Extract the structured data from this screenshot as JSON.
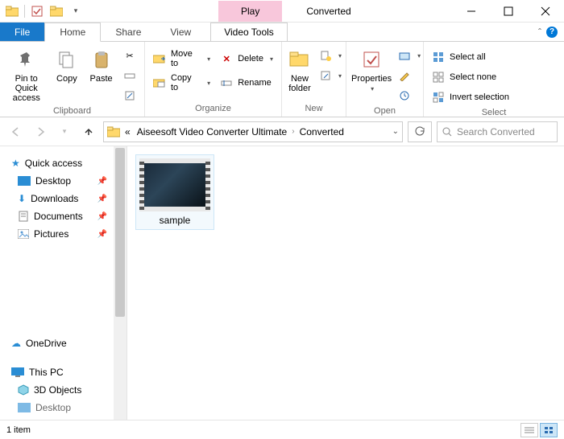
{
  "title": {
    "play": "Play",
    "context": "Video Tools",
    "window": "Converted"
  },
  "tabs": {
    "file": "File",
    "home": "Home",
    "share": "Share",
    "view": "View",
    "videotools": "Video Tools"
  },
  "ribbon": {
    "clipboard": {
      "pin": "Pin to Quick\naccess",
      "copy": "Copy",
      "paste": "Paste",
      "label": "Clipboard"
    },
    "organize": {
      "move": "Move to",
      "copyto": "Copy to",
      "delete": "Delete",
      "rename": "Rename",
      "label": "Organize"
    },
    "new": {
      "newfolder": "New\nfolder",
      "label": "New"
    },
    "open": {
      "properties": "Properties",
      "label": "Open"
    },
    "select": {
      "all": "Select all",
      "none": "Select none",
      "invert": "Invert selection",
      "label": "Select"
    }
  },
  "address": {
    "crumb_prefix": "«",
    "crumb1": "Aiseesoft Video Converter Ultimate",
    "crumb2": "Converted",
    "search_placeholder": "Search Converted"
  },
  "nav": {
    "quick": "Quick access",
    "desktop": "Desktop",
    "downloads": "Downloads",
    "documents": "Documents",
    "pictures": "Pictures",
    "onedrive": "OneDrive",
    "thispc": "This PC",
    "objects3d": "3D Objects",
    "desktop2": "Desktop"
  },
  "files": {
    "item1": "sample"
  },
  "status": {
    "count": "1 item"
  }
}
